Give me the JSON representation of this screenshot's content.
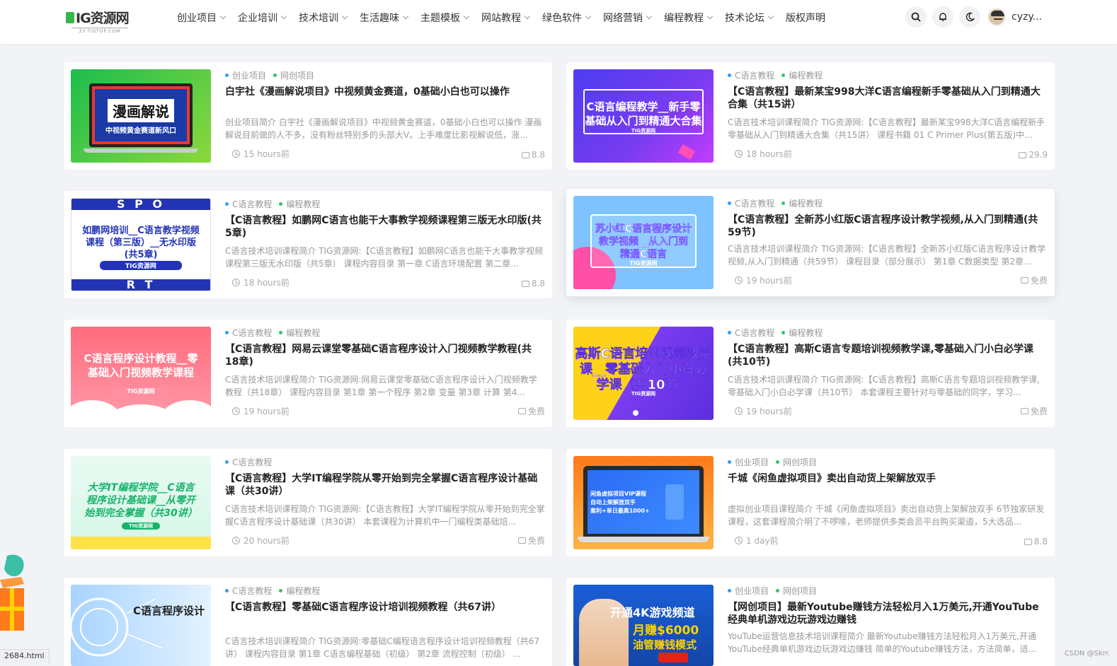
{
  "header": {
    "logo_text": "IG资源网",
    "logo_sub": "ZY.TIGTOP.COM",
    "nav": [
      {
        "label": "创业项目",
        "dropdown": true
      },
      {
        "label": "企业培训",
        "dropdown": true
      },
      {
        "label": "技术培训",
        "dropdown": true
      },
      {
        "label": "生活趣味",
        "dropdown": true
      },
      {
        "label": "主题模板",
        "dropdown": true
      },
      {
        "label": "网站教程",
        "dropdown": true
      },
      {
        "label": "绿色软件",
        "dropdown": true
      },
      {
        "label": "网络营销",
        "dropdown": true
      },
      {
        "label": "编程教程",
        "dropdown": true
      },
      {
        "label": "技术论坛",
        "dropdown": true
      },
      {
        "label": "版权声明",
        "dropdown": false
      }
    ],
    "icons": [
      "search-icon",
      "bell-icon",
      "moon-icon"
    ],
    "username": "cyzy..."
  },
  "colors": {
    "dot_blue": "#2f9bff",
    "dot_green": "#33c26d"
  },
  "posts": [
    {
      "cats": [
        "创业项目",
        "网创项目"
      ],
      "title": "白宇社《漫画解说项目》中视频黄金赛道，0基础小白也可以操作",
      "desc": "创业项目简介 白宇社《漫画解说项目》中视频黄金赛道，0基础小白也可以操作 漫画解说目前做的人不多，没有粉丝特别多的头部大V。上手难度比影视解说低，涨...",
      "time": "15 hours前",
      "price": "8.8",
      "thumb": {
        "line1": "漫画解说",
        "line2": "中视频黄金赛道新风口"
      }
    },
    {
      "cats": [
        "C语言教程",
        "编程教程"
      ],
      "title": "【C语言教程】最新某宝998大洋C语言编程新手零基础从入门到精通大合集（共15讲）",
      "desc": "C语言技术培训课程简介 TIG资源网:【C语言教程】最新某宝998大洋C语言编程新手零基础从入门到精通大合集（共15讲） 课程书籍 01 C Primer Plus(第五版)中...",
      "time": "18 hours前",
      "price": "29.9",
      "thumb": {
        "line1": "C语言编程教学__新手零",
        "line2": "基础从入门到精通大合集",
        "line3": "TIG资源网"
      }
    },
    {
      "cats": [
        "C语言教程",
        "编程教程"
      ],
      "title": "【C语言教程】如鹏网C语言也能干大事教学视频课程第三版无水印版(共5章)",
      "desc": "C语言技术培训课程简介 TIG资源网:【C语言教程】如鹏网C语言也能干大事教学视频课程第三版无水印版（共5章） 课程内容目录 第一章 C语言环境配置 第二章...",
      "time": "18 hours前",
      "price": "8.8",
      "thumb": {
        "line1": "如鹏网培训__C语言教学视频",
        "line2": "课程（第三版）__无水印版",
        "line3": "(共5章)",
        "line4": "TIG资源网",
        "top": "S  P  O",
        "bottom": "R  T"
      }
    },
    {
      "cats": [
        "C语言教程",
        "编程教程"
      ],
      "title": "【C语言教程】全新苏小红版C语言程序设计教学视频,从入门到精通(共59节)",
      "desc": "C语言技术培训课程简介 TIG资源网:【C语言教程】全新苏小红版C语言程序设计教学视频,从入门到精通（共59节） 课程目录（部分展示） 第1章 C数据类型 第2章...",
      "time": "19 hours前",
      "price": "免费",
      "thumb": {
        "line1": "苏小红C语言程序设计",
        "line2": "教学视频__从入门到",
        "line3": "精通C语言",
        "line4": "TIG资源网"
      }
    },
    {
      "cats": [
        "C语言教程",
        "编程教程"
      ],
      "title": "【C语言教程】网易云课堂零基础C语言程序设计入门视频教学教程(共18章)",
      "desc": "C语言技术培训课程简介 TIG资源网:网易云课堂零基础C语言程序设计入门视频教学教程（共18章） 课程内容目录 第1章 第一个程序 第2章 变量 第3章 计算 第4...",
      "time": "19 hours前",
      "price": "免费",
      "thumb": {
        "line1": "C语言程序设计教程__零",
        "line2": "基础入门视频教学课程",
        "line3": "TIG资源网"
      }
    },
    {
      "cats": [
        "C语言教程",
        "编程教程"
      ],
      "title": "【C语言教程】高斯C语言专题培训视频教学课,零基础入门小白必学课(共10节)",
      "desc": "C语言技术培训课程简介 TIG资源网:【C语言教程】高斯C语言专题培训视频教学课,零基础入门小白必学课（共10节） 本套课程主要针对与零基础的同学，学习...",
      "time": "19 hours前",
      "price": "免费",
      "thumb": {
        "line1": "高斯C语言培训视频教学",
        "line2": "课__零基础入门小白必",
        "line3": "学课（共10节）",
        "line4": "TIG资源网"
      }
    },
    {
      "cats": [
        "C语言教程"
      ],
      "title": "【C语言教程】大学IT编程学院从零开始到完全掌握C语言程序设计基础课（共30讲）",
      "desc": "C语言技术培训课程简介 TIG资源网:【C语言教程】大学IT编程学院从零开始到完全掌握C语言程序设计基础课（共30讲） 本套课程为计算机中一门编程类基础培...",
      "time": "20 hours前",
      "price": "免费",
      "thumb": {
        "line1": "大学IT编程学院__C语言",
        "line2": "程序设计基础课__从零开",
        "line3": "始到完全掌握（共30讲）",
        "line4": "TIG资源网"
      }
    },
    {
      "cats": [
        "创业项目",
        "网创项目"
      ],
      "title": "千城《闲鱼虚拟项目》卖出自动货上架解放双手",
      "desc": "虚拟创业项目课程简介 千城《闲鱼虚拟项目》卖出自动货上架解放双手 6节独家研发课程，这套课程简介明了不啰嗦，老师提供多类会员平台购买渠道，5大选品...",
      "time": "1 day前",
      "price": "8.8",
      "thumb": {
        "line1": "闲鱼虚拟项目VIP课程",
        "line2": "自动上架解放双手",
        "line3": "案利+单日最高1000+"
      }
    },
    {
      "cats": [
        "C语言教程",
        "编程教程"
      ],
      "title": "【C语言教程】零基础C语言程序设计培训视频教程（共67讲）",
      "desc": "C语言技术培训课程简介 TIG资源网:零基础C编程语言程序设计培训视频教程（共67讲） 课程内容目录 第1章 C语言编程基础（初级） 第2章 流程控制（初级） ...",
      "time": "",
      "price": "",
      "thumb": {
        "line1": "C语言程序设计"
      }
    },
    {
      "cats": [
        "创业项目",
        "网创项目"
      ],
      "title": "【网创项目】最新Youtube赚钱方法轻松月入1万美元,开通YouTube经典单机游戏边玩游戏边赚钱",
      "desc": "YouTube运营信息技术培训课程简介 最新Youtube赚钱方法轻松月入1万美元,开通YouTube经典单机游戏边玩游戏边赚钱 简单的Youtube赚钱方法，方法简单，适...",
      "time": "",
      "price": "",
      "thumb": {
        "line1": "开通4K游戏频道",
        "line2": "月赚$6000",
        "line3": "油管赚钱模式"
      }
    }
  ],
  "status_url": "2684.html",
  "watermark": "CSDN @Skrr."
}
